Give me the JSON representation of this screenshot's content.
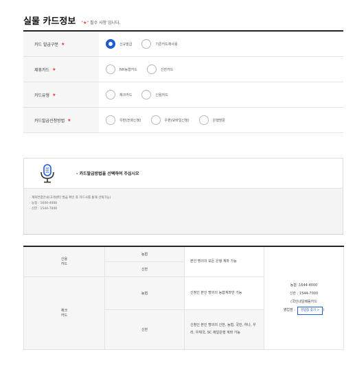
{
  "page": {
    "title": "실물 카드정보",
    "required_note_star": "\"★\"",
    "required_note_text": "필수 사항 입니다."
  },
  "form": {
    "rows": [
      {
        "label": "카드 발급구분",
        "options": [
          "신규발급",
          "기존카드재사용"
        ],
        "selected": 0
      },
      {
        "label": "제휴카드",
        "options": [
          "NH농협카드",
          "신한카드"
        ],
        "selected": -1
      },
      {
        "label": "카드유형",
        "options": [
          "체크카드",
          "신용카드"
        ],
        "selected": -1
      },
      {
        "label": "카드발급신청방법",
        "options": [
          "우편(전화신청)",
          "우편(모바일신청)",
          "은행방문"
        ],
        "selected": -1
      }
    ],
    "required_mark": "★"
  },
  "info": {
    "icon": "microphone-icon",
    "prompt": "- 카드발급방법을 선택하여 주십시오",
    "notes": [
      "· 계좌연결안내(고객센터 발급 확인 후 카드사를 통해 선택가능)",
      "· 농협 : 1644-4000",
      "· 신한 : 1544-7000"
    ]
  },
  "table": {
    "credit_label": "신용\n카드",
    "check_label": "체크\n카드",
    "credit_nh": "농협",
    "credit_sh": "신한",
    "credit_desc": "본인 명의의 모든 은행 계좌 가능",
    "check_nh": "농협",
    "check_nh_desc": "신청인 본인 명의의 농협계좌만 가능",
    "check_sh": "신한",
    "check_sh_desc": "신청인 본인 명의의 신한, 농협, 국민, 하나, 우리, 우체국, SC 제일은행 계좌 가능",
    "contact_nh": "농협 :1644-4000",
    "contact_sh": "신한 : 1544-7000",
    "contact_sub": "(국민내일배움카드",
    "contact_branch_label": "영업점 :",
    "contact_branch_button": "영업점 찾기 >",
    "contact_branch_close": ")"
  },
  "colors": {
    "accent": "#1e5bd8",
    "required": "#e4342f"
  }
}
